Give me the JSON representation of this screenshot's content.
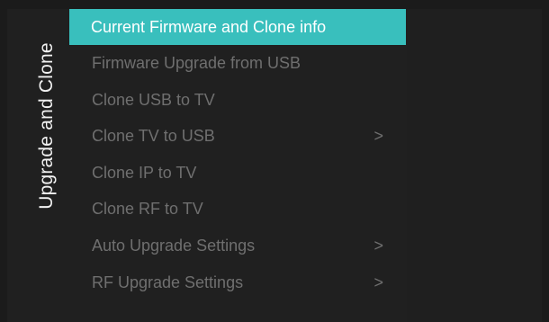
{
  "sidebar": {
    "title": "Upgrade and Clone"
  },
  "menu": {
    "items": [
      {
        "label": "Current Firmware and Clone info",
        "chevron": ""
      },
      {
        "label": "Firmware Upgrade from USB",
        "chevron": ""
      },
      {
        "label": "Clone USB to TV",
        "chevron": ""
      },
      {
        "label": "Clone TV to USB",
        "chevron": ">"
      },
      {
        "label": "Clone IP to TV",
        "chevron": ""
      },
      {
        "label": "Clone RF to TV",
        "chevron": ""
      },
      {
        "label": "Auto Upgrade Settings",
        "chevron": ">"
      },
      {
        "label": "RF Upgrade Settings",
        "chevron": ">"
      }
    ],
    "selected_index": 0
  },
  "colors": {
    "background": "#1b1b1b",
    "panel": "#202020",
    "accent": "#39bfbd",
    "text_active": "#ffffff",
    "text_inactive": "#6f6f6f"
  }
}
